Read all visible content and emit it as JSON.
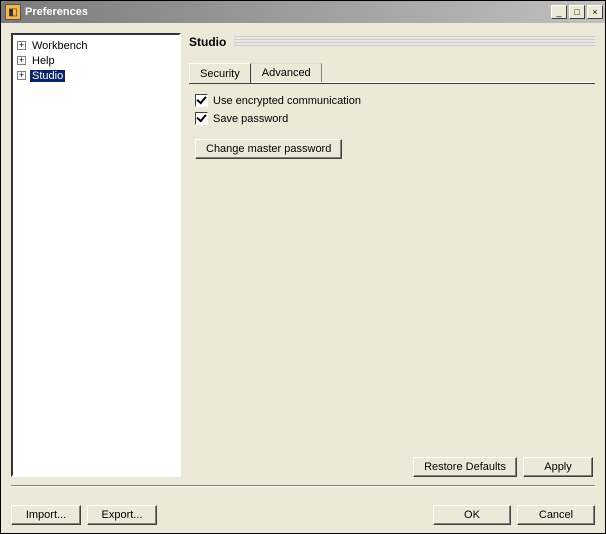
{
  "window": {
    "title": "Preferences"
  },
  "tree": {
    "items": [
      {
        "label": "Workbench",
        "selected": false
      },
      {
        "label": "Help",
        "selected": false
      },
      {
        "label": "Studio",
        "selected": true
      }
    ]
  },
  "section": {
    "title": "Studio"
  },
  "tabs": [
    {
      "label": "Security",
      "active": true
    },
    {
      "label": "Advanced",
      "active": false
    }
  ],
  "security": {
    "use_encrypted_label": "Use encrypted communication",
    "use_encrypted_checked": true,
    "save_password_label": "Save password",
    "save_password_checked": true,
    "change_master_label": "Change master password"
  },
  "buttons": {
    "restore_defaults": "Restore Defaults",
    "apply": "Apply",
    "import": "Import...",
    "export": "Export...",
    "ok": "OK",
    "cancel": "Cancel"
  }
}
